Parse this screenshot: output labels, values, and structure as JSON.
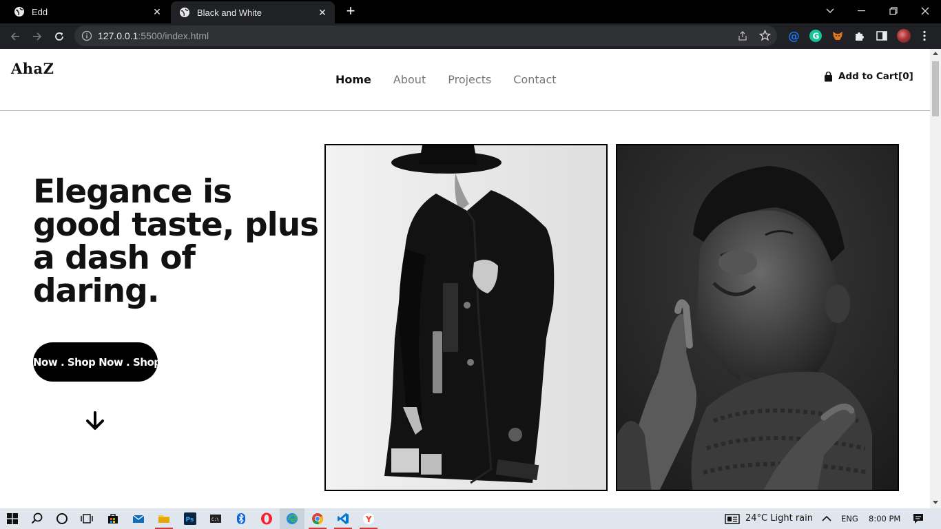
{
  "browser": {
    "tabs": [
      {
        "title": "Edd",
        "active": false
      },
      {
        "title": "Black and White",
        "active": true
      }
    ],
    "url_host": "127.0.0.1",
    "url_rest": ":5500/index.html"
  },
  "site": {
    "logo": "AhaZ",
    "nav": [
      {
        "label": "Home",
        "active": true
      },
      {
        "label": "About",
        "active": false
      },
      {
        "label": "Projects",
        "active": false
      },
      {
        "label": "Contact",
        "active": false
      }
    ],
    "cart_label": "Add to Cart",
    "cart_count": "[0]",
    "headline": "Elegance is good taste, plus a dash of daring.",
    "shop_button": "Now . Shop Now . Shop"
  },
  "taskbar": {
    "weather": "24°C  Light rain",
    "language": "ENG",
    "time": "8:00 PM"
  },
  "colors": {
    "tabbar": "#000000",
    "toolbar": "#202124",
    "accent": "#111111",
    "nav_inactive": "#777777",
    "taskbar": "#dfe6ee"
  }
}
